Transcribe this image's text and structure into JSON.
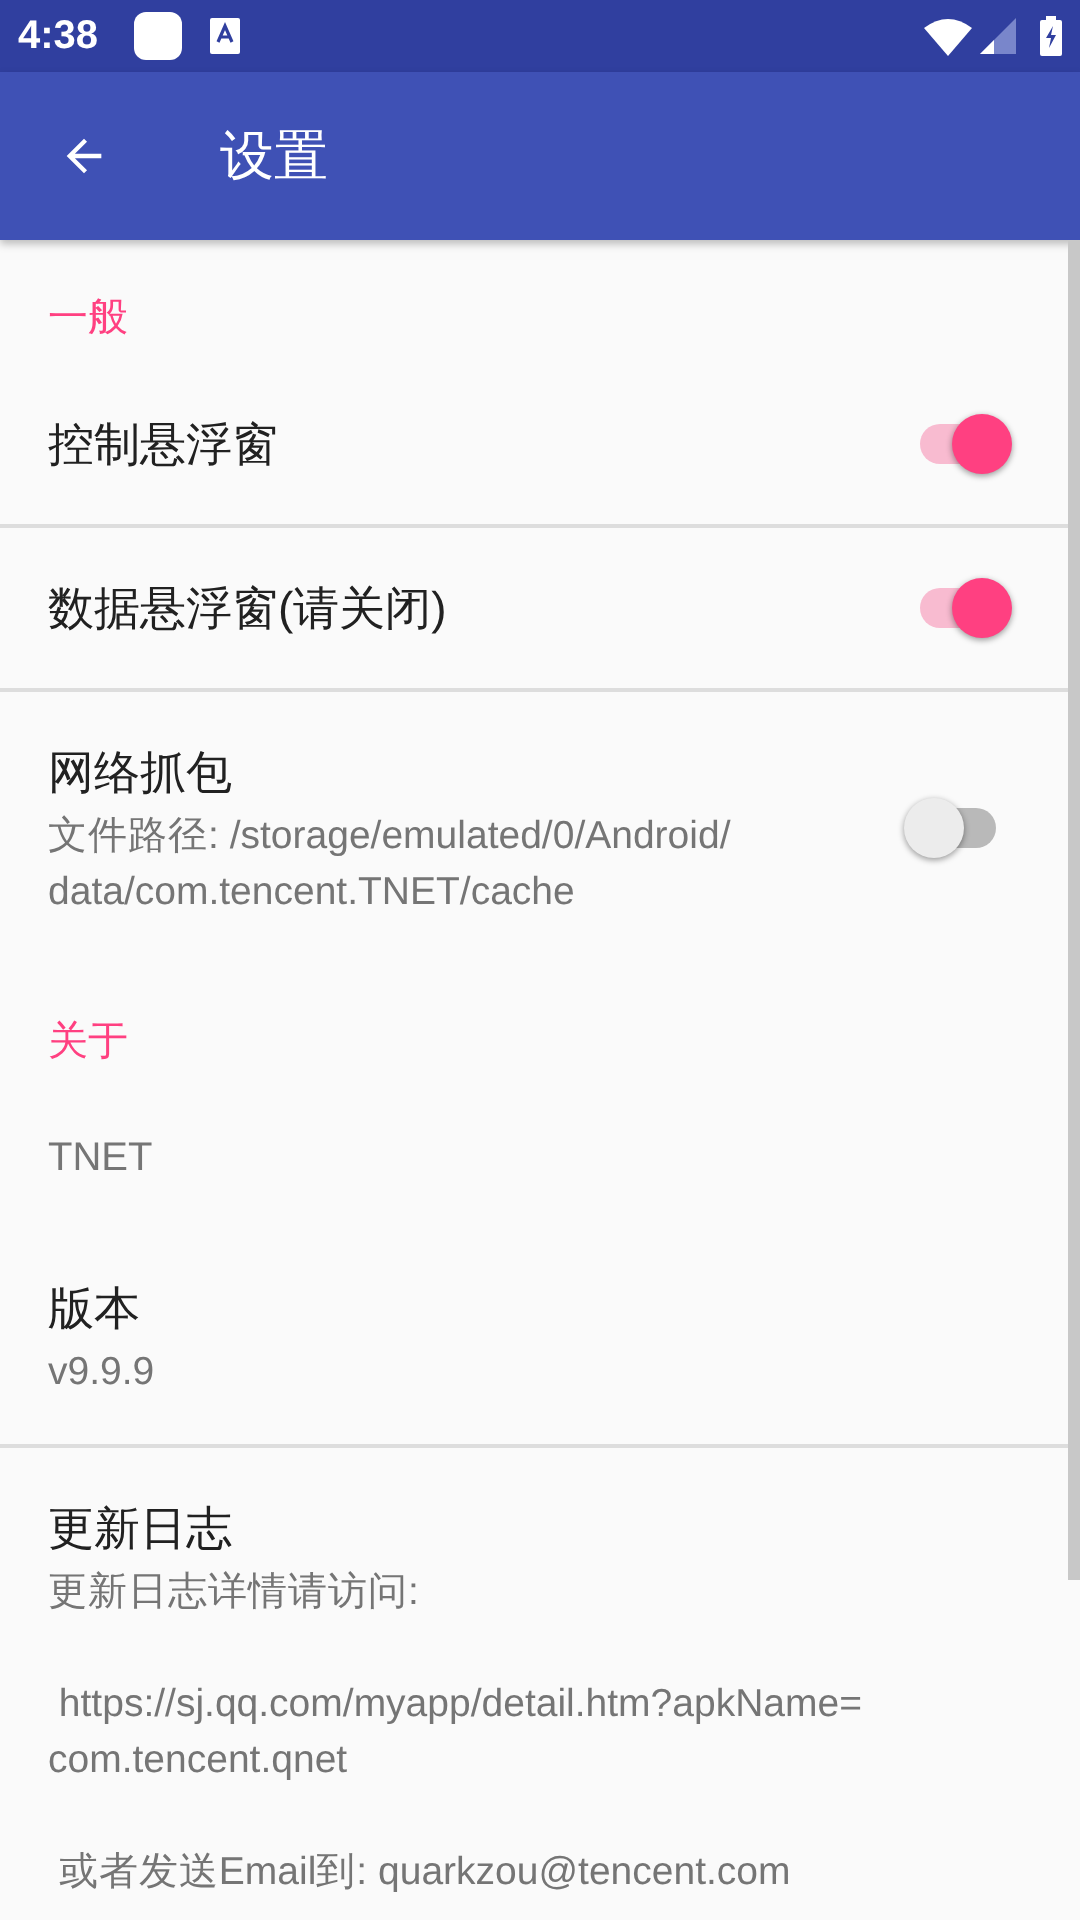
{
  "status_bar": {
    "time": "4:38"
  },
  "toolbar": {
    "title": "设置"
  },
  "items": [
    {
      "kind": "category",
      "title": "一般"
    },
    {
      "kind": "switch",
      "title": "控制悬浮窗",
      "on": true,
      "divider": true
    },
    {
      "kind": "switch",
      "title": "数据悬浮窗(请关闭)",
      "on": true,
      "divider": true
    },
    {
      "kind": "switch",
      "title": "网络抓包",
      "summary": "文件路径: /storage/emulated/0/Android/\ndata/com.tencent.TNET/cache",
      "on": false,
      "divider": false
    },
    {
      "kind": "category",
      "title": "关于"
    },
    {
      "kind": "note",
      "title": "TNET"
    },
    {
      "kind": "preference",
      "title": "版本",
      "summary": "v9.9.9",
      "divider": true
    },
    {
      "kind": "preference",
      "title": "更新日志",
      "summary": "更新日志详情请访问:\n\n https://sj.qq.com/myapp/detail.htm?apkName=\ncom.tencent.qnet\n\n 或者发送Email到: quarkzou@tencent.com",
      "divider": false
    }
  ]
}
